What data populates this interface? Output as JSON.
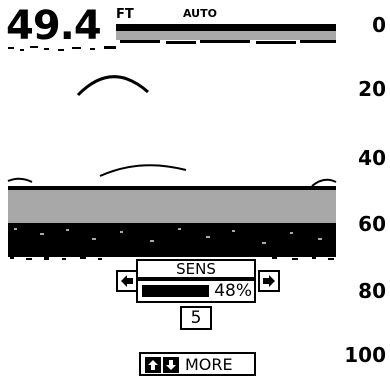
{
  "depth": {
    "value": "49.4",
    "unit": "FT"
  },
  "range_mode": "AUTO",
  "depth_scale": [
    "0",
    "20",
    "40",
    "60",
    "80",
    "100"
  ],
  "sensitivity": {
    "label": "SENS",
    "percent_text": "48%",
    "level_fraction": 0.48,
    "level_value": "5"
  },
  "more_button": {
    "label": "MORE"
  },
  "icons": {
    "left": "arrow-left-icon",
    "right": "arrow-right-icon",
    "up": "arrow-up-icon",
    "down": "arrow-down-icon"
  },
  "colors": {
    "ink": "#000000",
    "bottom_gray": "#a8a8a8",
    "background": "#ffffff"
  }
}
